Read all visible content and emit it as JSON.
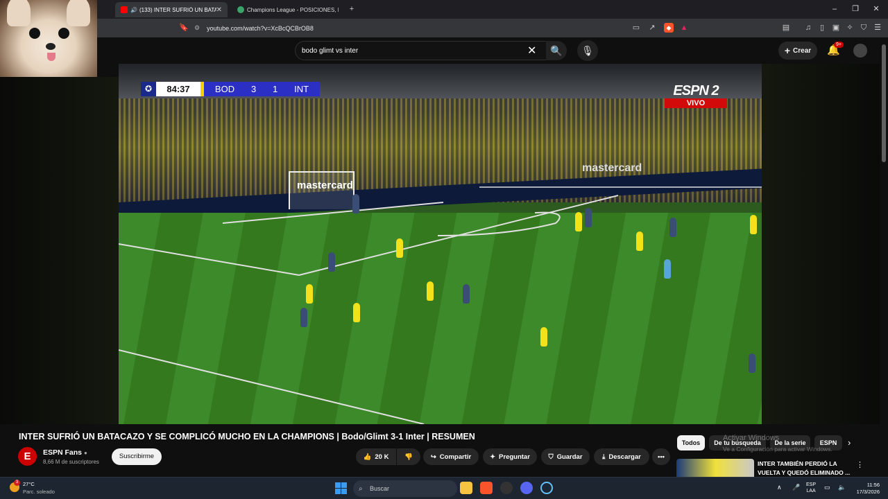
{
  "browser": {
    "tabs": [
      {
        "title": "(133) INTER SUFRIÓ UN BATA",
        "active": true,
        "audio_icon": "speaker-icon"
      },
      {
        "title": "Champions League - POSICIONES, R",
        "active": false
      }
    ],
    "url": "youtube.com/watch?v=XcBcQCBrOB8"
  },
  "youtube": {
    "search_query": "bodo glimt vs inter",
    "create_label": "Crear",
    "notification_count": "9+"
  },
  "video": {
    "scorebug": {
      "clock": "84:37",
      "home": "BOD",
      "home_score": "3",
      "away_score": "1",
      "away": "INT"
    },
    "broadcaster": "ESPN 2",
    "live_label": "VIVO",
    "ad_text": "mastercard"
  },
  "details": {
    "title": "INTER SUFRIÓ UN BATACAZO Y SE COMPLICÓ MUCHO EN LA CHAMPIONS | Bodo/Glimt 3-1 Inter | RESUMEN",
    "channel": "ESPN Fans",
    "subscribers": "8,66 M de suscriptores",
    "subscribe_label": "Suscribirme",
    "likes": "20 K",
    "share_label": "Compartir",
    "ask_label": "Preguntar",
    "save_label": "Guardar",
    "download_label": "Descargar"
  },
  "sidebar": {
    "chips": [
      "Todos",
      "De tu búsqueda",
      "De la serie",
      "ESPN"
    ],
    "recommended_title": "INTER TAMBIÉN PERDIÓ LA VUELTA Y QUEDÓ ELIMINADO ...",
    "watermark": "Activar Windows",
    "watermark_sub": "Ve a Configuración para activar Windows."
  },
  "taskbar": {
    "temperature": "27°C",
    "weather": "Parc. soleado",
    "weather_badge": "3",
    "search_label": "Buscar",
    "lang": "ESP",
    "lang_sub": "LAA",
    "time": "11:56",
    "date": "17/3/2026"
  },
  "colors": {
    "accent": "#cc0000",
    "scorebug_blue": "#2b2fc4",
    "scorebug_yellow": "#f5d000"
  }
}
